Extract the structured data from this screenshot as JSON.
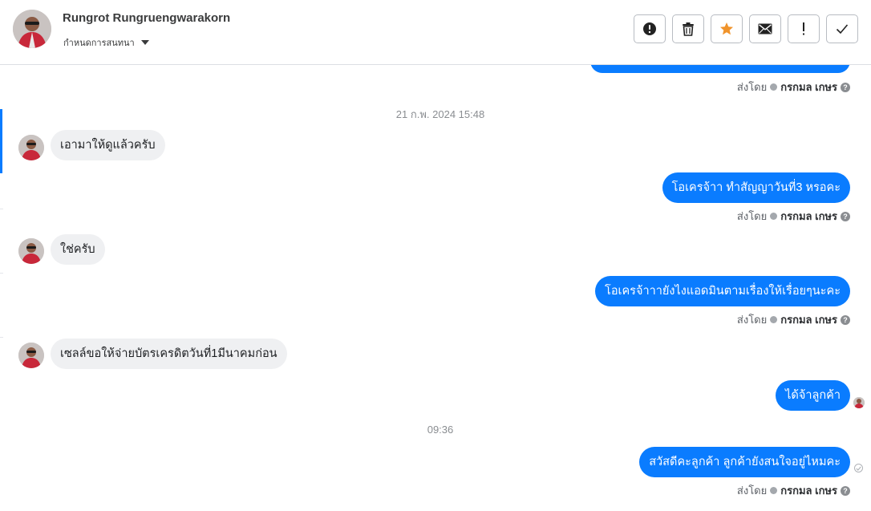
{
  "contact": {
    "name": "Rungrot Rungruengwarakorn",
    "assign_label": "กำหนดการสนทนา"
  },
  "toolbar": {
    "buttons": [
      {
        "name": "report",
        "icon": "alert-circle-icon"
      },
      {
        "name": "delete",
        "icon": "trash-icon"
      },
      {
        "name": "star",
        "icon": "star-icon",
        "color": "#f0932b"
      },
      {
        "name": "mail",
        "icon": "envelope-icon"
      },
      {
        "name": "important",
        "icon": "exclamation-icon"
      },
      {
        "name": "done",
        "icon": "check-icon"
      }
    ]
  },
  "colors": {
    "outgoing_bubble": "#0a7cff",
    "incoming_bubble": "#eff0f2",
    "accent": "#0a7cff"
  },
  "sent_by": {
    "prefix": "ส่งโดย",
    "agent": "กรกมล เกษร"
  },
  "chat": {
    "timestamp_1": "21 ก.พ. 2024 15:48",
    "timestamp_2": "09:36",
    "messages": [
      {
        "dir": "out",
        "text": "",
        "partial": true
      },
      {
        "dir": "in",
        "text": "เอามาให้ดูแล้วครับ"
      },
      {
        "dir": "out",
        "text": "โอเครจ้าา ทำสัญญาวันที่3 หรอคะ"
      },
      {
        "dir": "in",
        "text": "ใช่ครับ"
      },
      {
        "dir": "out",
        "text": "โอเครจ้าาายังไงแอดมินตามเรื่องให้เรื่อยๆนะคะ"
      },
      {
        "dir": "in",
        "text": "เซลล์ขอให้จ่ายบัตรเครดิตวันที่1มีนาคมก่อน"
      },
      {
        "dir": "out",
        "text": "ได้จ้าลูกค้า"
      },
      {
        "dir": "out",
        "text": "สวัสดีคะลูกค้า ลูกค้ายังสนใจอยู่ไหมคะ"
      }
    ]
  }
}
